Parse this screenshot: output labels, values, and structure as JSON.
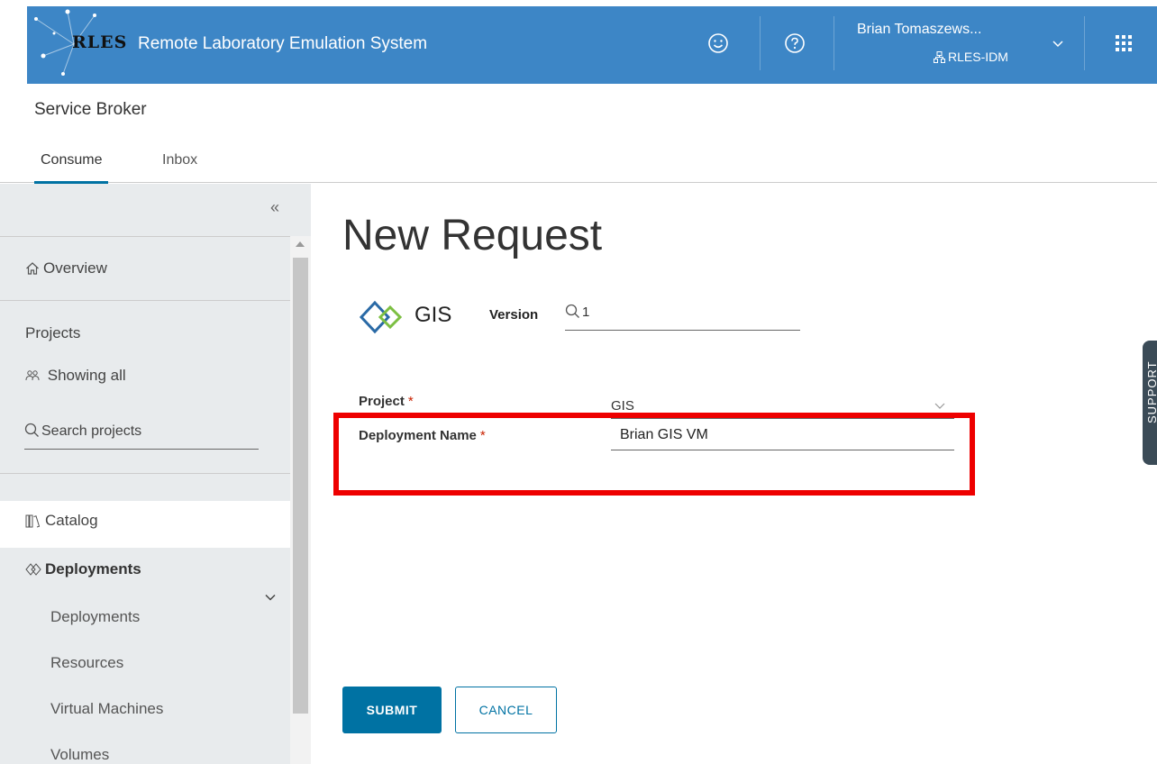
{
  "header": {
    "logo_text": "RLES",
    "app_title": "Remote Laboratory Emulation System",
    "user_name": "Brian Tomaszews...",
    "user_org": "RLES-IDM",
    "brand_color": "#3d86c6",
    "icons": [
      "smiley-icon",
      "help-icon",
      "chevron-down-icon",
      "app-grid-icon"
    ]
  },
  "service_title": "Service Broker",
  "tabs": [
    {
      "label": "Consume",
      "active": true
    },
    {
      "label": "Inbox",
      "active": false
    }
  ],
  "sidebar": {
    "collapse_glyph": "«",
    "overview": "Overview",
    "projects_heading": "Projects",
    "projects_filter": "Showing all",
    "search_placeholder": "Search projects",
    "catalog": "Catalog",
    "deployments_group": "Deployments",
    "sub_items": [
      "Deployments",
      "Resources",
      "Virtual Machines",
      "Volumes"
    ]
  },
  "main": {
    "page_title": "New Request",
    "catalog_item_name": "GIS",
    "version_label": "Version",
    "version_value": "1",
    "project_label": "Project",
    "project_value": "GIS",
    "deployment_name_label": "Deployment Name",
    "deployment_name_value": "Brian GIS VM",
    "required_marker": "*",
    "submit_label": "SUBMIT",
    "cancel_label": "CANCEL",
    "highlight_color": "#ee0000"
  },
  "support_tab": "SUPPORT"
}
